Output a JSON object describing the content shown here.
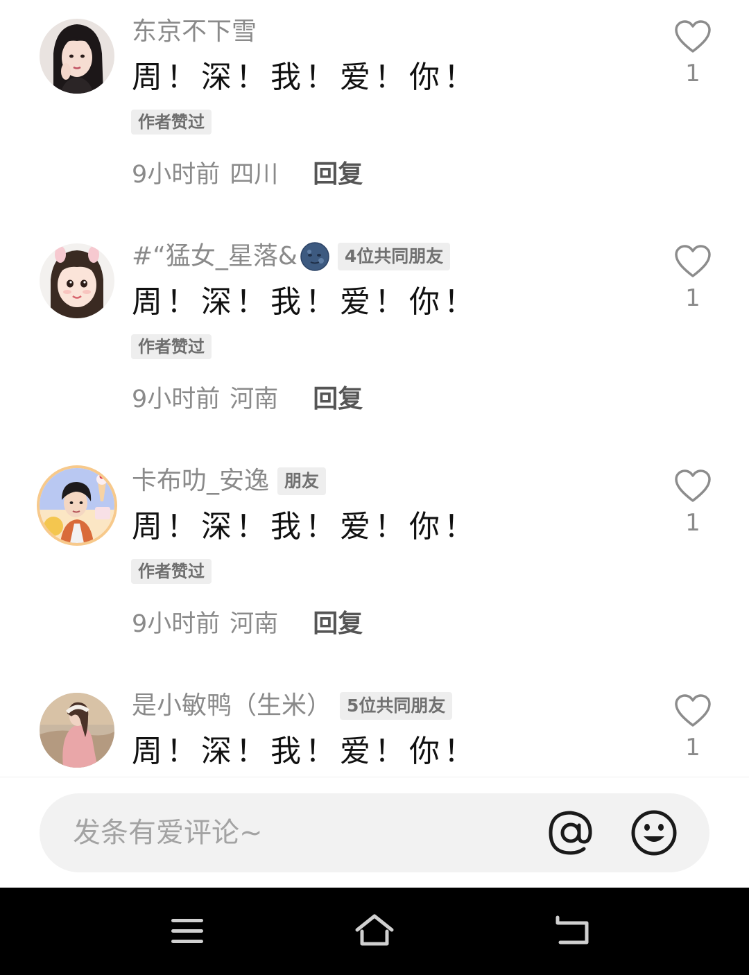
{
  "comments": [
    {
      "username": "东京不下雪",
      "tag": "",
      "text": "周！深！我！爱！你！",
      "author_liked": "作者赞过",
      "time": "9小时前",
      "location": "四川",
      "reply": "回复",
      "likes": "1"
    },
    {
      "username": "#“猛女_星落&",
      "tag": "4位共同朋友",
      "text": "周！深！我！爱！你！",
      "author_liked": "作者赞过",
      "time": "9小时前",
      "location": "河南",
      "reply": "回复",
      "likes": "1"
    },
    {
      "username": "卡布叻_安逸",
      "tag": "朋友",
      "text": "周！深！我！爱！你！",
      "author_liked": "作者赞过",
      "time": "9小时前",
      "location": "河南",
      "reply": "回复",
      "likes": "1"
    },
    {
      "username": "是小敏鸭（生米）",
      "tag": "5位共同朋友",
      "text": "周！深！我！爱！你！",
      "likes": "1"
    }
  ],
  "input": {
    "placeholder": "发条有爱评论~"
  },
  "icons": {
    "like": "heart-outline-icon",
    "mention": "at-icon",
    "emoji": "smiley-icon",
    "nav_menu": "menu-icon",
    "nav_home": "home-icon",
    "nav_back": "back-icon"
  }
}
